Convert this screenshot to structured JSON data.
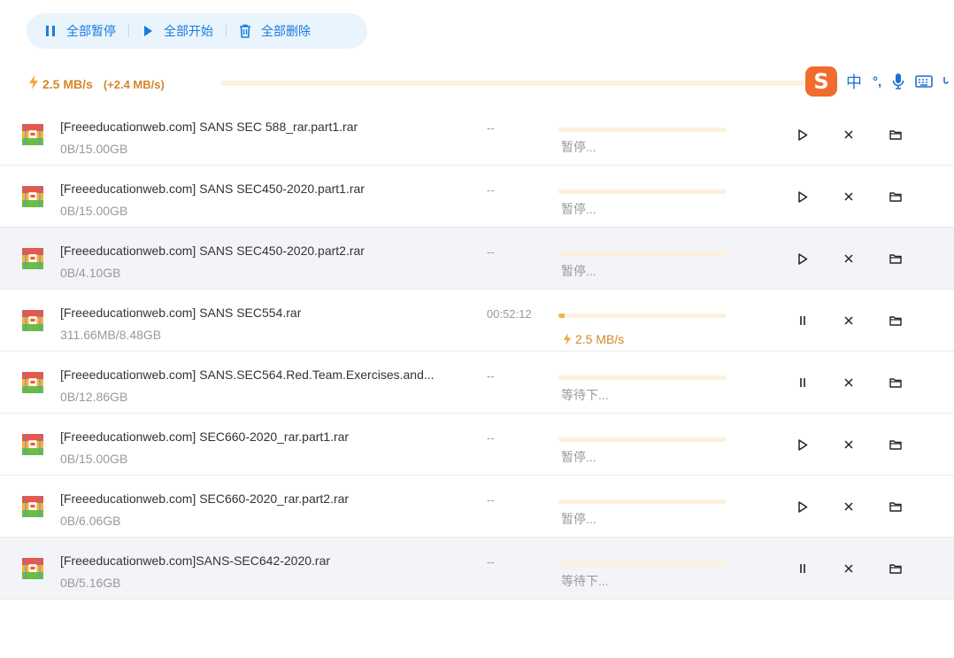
{
  "toolbar": {
    "pause_all": "全部暂停",
    "start_all": "全部开始",
    "delete_all": "全部删除"
  },
  "speed": {
    "current": "2.5 MB/s",
    "extra": "(+2.4 MB/s)"
  },
  "ime": {
    "logo": "S",
    "mode": "中",
    "punct": "°,",
    "mic_icon": "microphone-icon",
    "keyboard_icon": "keyboard-icon"
  },
  "colors": {
    "accent": "#1a7be0",
    "speed": "#d4872c",
    "track": "#fdf0de",
    "fill": "#f3b24a"
  },
  "downloads": [
    {
      "name": "[Freeeducationweb.com] SANS SEC 588_rar.part1.rar",
      "size": "0B/15.00GB",
      "eta": "--",
      "status": "暂停...",
      "state": "paused",
      "progress": 0
    },
    {
      "name": "[Freeeducationweb.com] SANS SEC450-2020.part1.rar",
      "size": "0B/15.00GB",
      "eta": "--",
      "status": "暂停...",
      "state": "paused",
      "progress": 0
    },
    {
      "name": "[Freeeducationweb.com] SANS SEC450-2020.part2.rar",
      "size": "0B/4.10GB",
      "eta": "--",
      "status": "暂停...",
      "state": "paused",
      "progress": 0
    },
    {
      "name": "[Freeeducationweb.com] SANS SEC554.rar",
      "size": "311.66MB/8.48GB",
      "eta": "00:52:12",
      "status": "2.5 MB/s",
      "state": "downloading",
      "progress": 0.036
    },
    {
      "name": "[Freeeducationweb.com] SANS.SEC564.Red.Team.Exercises.and...",
      "size": "0B/12.86GB",
      "eta": "--",
      "status": "等待下...",
      "state": "waiting",
      "progress": 0
    },
    {
      "name": "[Freeeducationweb.com] SEC660-2020_rar.part1.rar",
      "size": "0B/15.00GB",
      "eta": "--",
      "status": "暂停...",
      "state": "paused",
      "progress": 0
    },
    {
      "name": "[Freeeducationweb.com] SEC660-2020_rar.part2.rar",
      "size": "0B/6.06GB",
      "eta": "--",
      "status": "暂停...",
      "state": "paused",
      "progress": 0
    },
    {
      "name": "[Freeeducationweb.com]SANS-SEC642-2020.rar",
      "size": "0B/5.16GB",
      "eta": "--",
      "status": "等待下...",
      "state": "waiting",
      "progress": 0
    }
  ]
}
